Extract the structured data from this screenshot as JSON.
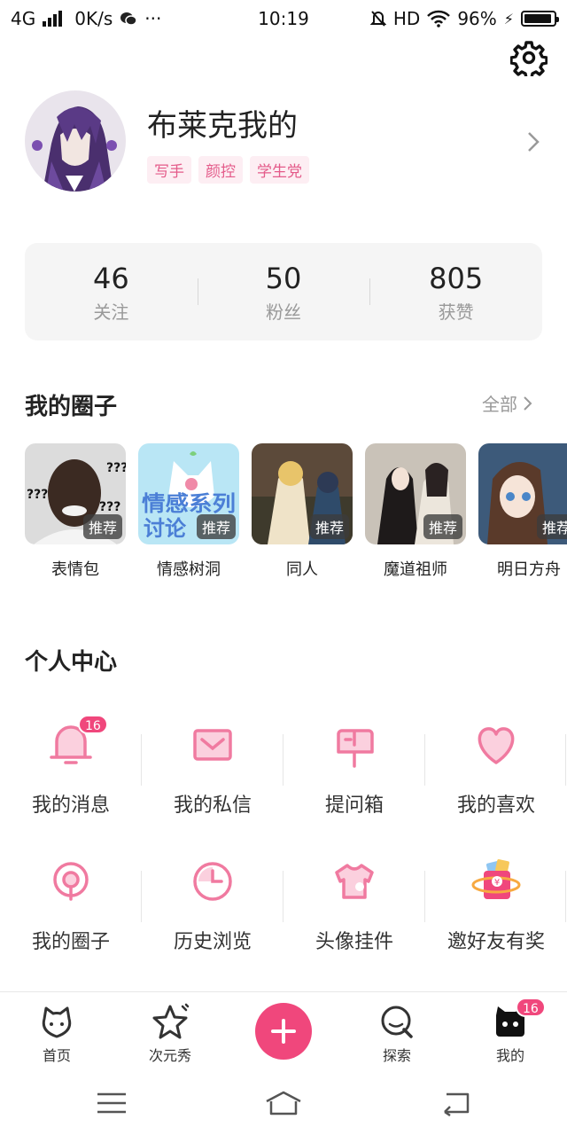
{
  "status_bar": {
    "network": "4G",
    "speed": "0K/s",
    "more": "···",
    "time": "10:19",
    "hd": "HD",
    "battery": "96%"
  },
  "profile": {
    "name": "布莱克我的",
    "tags": [
      "写手",
      "颜控",
      "学生党"
    ]
  },
  "stats": [
    {
      "value": "46",
      "label": "关注"
    },
    {
      "value": "50",
      "label": "粉丝"
    },
    {
      "value": "805",
      "label": "获赞"
    }
  ],
  "my_circles": {
    "title": "我的圈子",
    "see_all": "全部",
    "items": [
      {
        "name": "表情包",
        "badge": "推荐",
        "image_text": "???"
      },
      {
        "name": "情感树洞",
        "badge": "推荐",
        "image_text": "情感系列讨论"
      },
      {
        "name": "同人",
        "badge": "推荐"
      },
      {
        "name": "魔道祖师",
        "badge": "推荐"
      },
      {
        "name": "明日方舟",
        "badge": "推荐"
      }
    ]
  },
  "personal_center": {
    "title": "个人中心",
    "items": [
      {
        "label": "我的消息",
        "icon": "bell-icon",
        "badge": "16"
      },
      {
        "label": "我的私信",
        "icon": "mail-icon"
      },
      {
        "label": "提问箱",
        "icon": "mailbox-icon"
      },
      {
        "label": "我的喜欢",
        "icon": "heart-icon"
      },
      {
        "label": "我的圈子",
        "icon": "circle-pin-icon"
      },
      {
        "label": "历史浏览",
        "icon": "clock-icon"
      },
      {
        "label": "头像挂件",
        "icon": "tshirt-icon"
      },
      {
        "label": "邀好友有奖",
        "icon": "gift-planet-icon"
      }
    ]
  },
  "tab_bar": {
    "tabs": [
      {
        "label": "首页",
        "icon": "home-cat-icon"
      },
      {
        "label": "次元秀",
        "icon": "star-icon"
      },
      {
        "label": "探索",
        "icon": "search-icon"
      },
      {
        "label": "我的",
        "icon": "me-cat-icon",
        "badge": "16"
      }
    ]
  },
  "colors": {
    "accent": "#f0477c",
    "icon_pink": "#f07aa0",
    "tag_bg": "#fdeef3",
    "tag_text": "#e45b8a",
    "stats_bg": "#f5f5f5"
  }
}
